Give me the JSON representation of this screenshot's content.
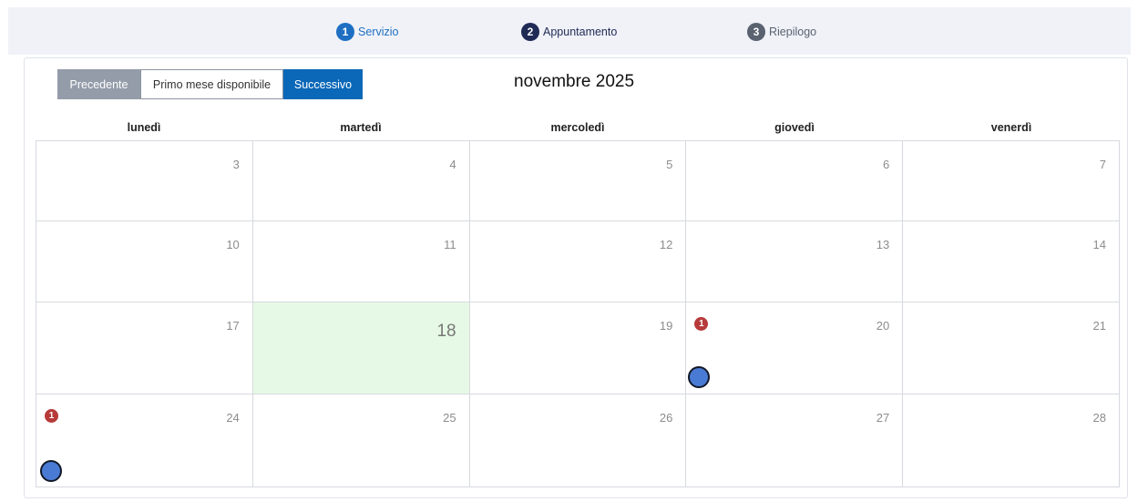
{
  "stepper": {
    "steps": [
      {
        "num": "1",
        "label": "Servizio"
      },
      {
        "num": "2",
        "label": "Appuntamento"
      },
      {
        "num": "3",
        "label": "Riepilogo"
      }
    ]
  },
  "toolbar": {
    "prev_label": "Precedente",
    "first_available_label": "Primo mese disponibile",
    "next_label": "Successivo"
  },
  "calendar": {
    "month_title": "novembre 2025",
    "weekdays": [
      "lunedì",
      "martedì",
      "mercoledì",
      "giovedì",
      "venerdì"
    ],
    "weeks": [
      [
        "3",
        "4",
        "5",
        "6",
        "7"
      ],
      [
        "10",
        "11",
        "12",
        "13",
        "14"
      ],
      [
        "17",
        "18",
        "19",
        "20",
        "21"
      ],
      [
        "24",
        "25",
        "26",
        "27",
        "28"
      ]
    ],
    "today": "18",
    "badges": {
      "20": "1",
      "24": "1"
    }
  },
  "colors": {
    "accent": "#1e6fc2",
    "next_button": "#0b68b8",
    "prev_button": "#949ca9",
    "today_bg": "#e6f9e6",
    "badge": "#b73a3a",
    "availability_dot": "#4a7bd4"
  }
}
